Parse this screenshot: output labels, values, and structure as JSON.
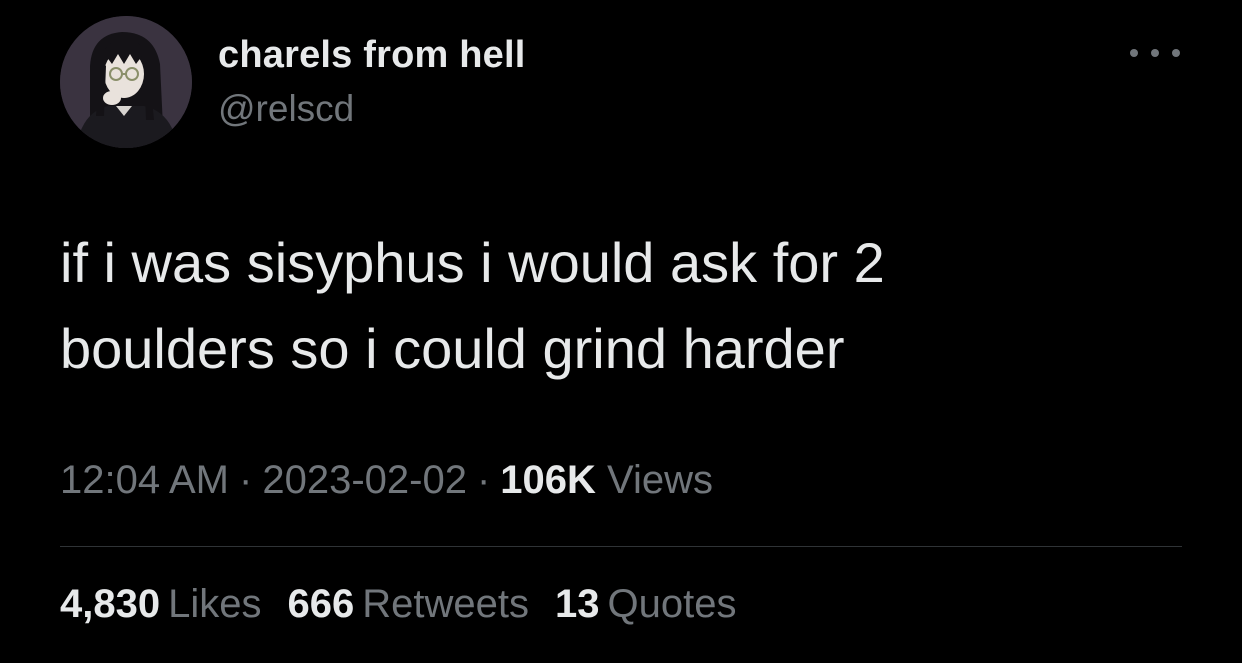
{
  "author": {
    "display_name": "charels from hell",
    "handle": "@relscd"
  },
  "more_icon": "ellipsis-icon",
  "tweet": {
    "lines": [
      "if i was sisyphus i would ask for 2",
      "boulders so i could grind harder"
    ]
  },
  "meta": {
    "time": "12:04 AM",
    "separator": "·",
    "date": "2023-02-02",
    "views_count": "106K",
    "views_label": "Views"
  },
  "stats": {
    "likes_count": "4,830",
    "likes_label": "Likes",
    "retweets_count": "666",
    "retweets_label": "Retweets",
    "quotes_count": "13",
    "quotes_label": "Quotes"
  },
  "colors": {
    "background": "#000000",
    "primary_text": "#e7e9ea",
    "secondary_text": "#71767b",
    "divider": "#2f3336"
  }
}
